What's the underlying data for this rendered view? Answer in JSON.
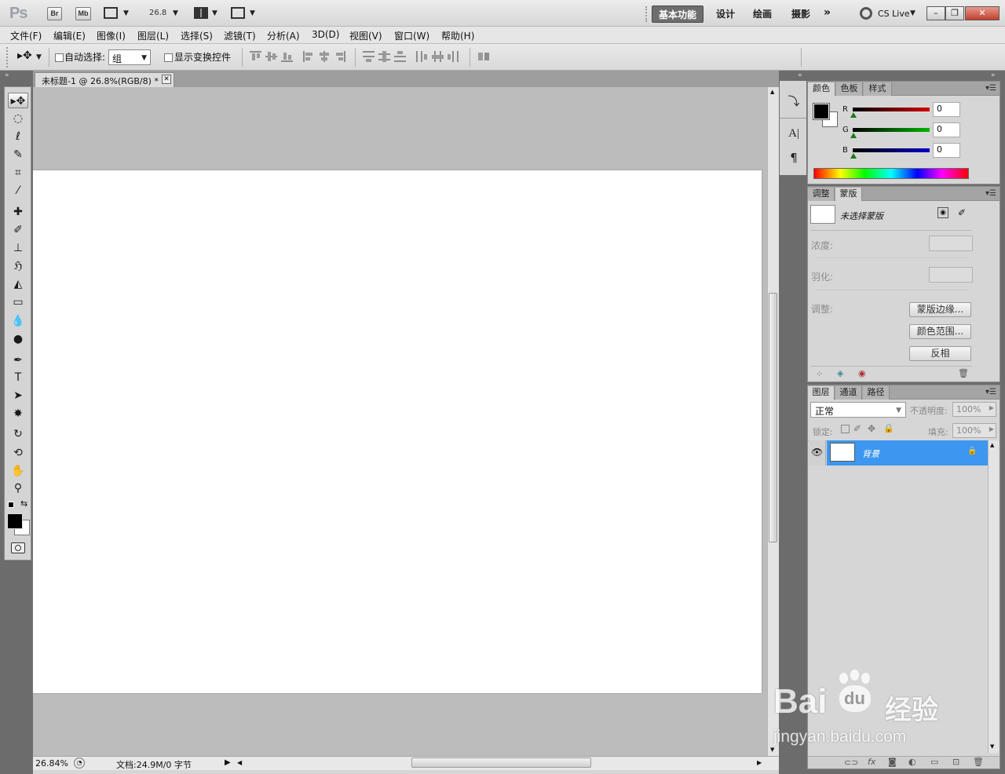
{
  "app": {
    "logo": "Ps",
    "bridge": "Br",
    "minibridge": "Mb",
    "zoom_display": "26.8"
  },
  "workspaces": [
    "基本功能",
    "设计",
    "绘画",
    "摄影"
  ],
  "workspace_active": "基本功能",
  "cs_live": "CS Live",
  "window_controls": {
    "min": "–",
    "restore": "❐",
    "close": "✕"
  },
  "menu": [
    "文件(F)",
    "编辑(E)",
    "图像(I)",
    "图层(L)",
    "选择(S)",
    "滤镜(T)",
    "分析(A)",
    "3D(D)",
    "视图(V)",
    "窗口(W)",
    "帮助(H)"
  ],
  "options": {
    "auto_select_label": "自动选择:",
    "auto_select_value": "组",
    "show_transform_label": "显示变换控件"
  },
  "document": {
    "tab_title": "未标题-1 @ 26.8%(RGB/8) *",
    "close": "✕",
    "zoom_status": "26.84%",
    "doc_info": "文档:24.9M/0 字节"
  },
  "tools": [
    {
      "name": "move-tool",
      "glyph": "▸✥"
    },
    {
      "name": "marquee-tool",
      "glyph": "◌"
    },
    {
      "name": "lasso-tool",
      "glyph": "ℓ"
    },
    {
      "name": "quick-select-tool",
      "glyph": "✎"
    },
    {
      "name": "crop-tool",
      "glyph": "⌗"
    },
    {
      "name": "eyedropper-tool",
      "glyph": "⁄"
    },
    {
      "name": "healing-brush-tool",
      "glyph": "✚"
    },
    {
      "name": "brush-tool",
      "glyph": "✐"
    },
    {
      "name": "clone-stamp-tool",
      "glyph": "⊥"
    },
    {
      "name": "history-brush-tool",
      "glyph": "ℌ"
    },
    {
      "name": "eraser-tool",
      "glyph": "◭"
    },
    {
      "name": "gradient-tool",
      "glyph": "▭"
    },
    {
      "name": "blur-tool",
      "glyph": "💧"
    },
    {
      "name": "dodge-tool",
      "glyph": "●"
    },
    {
      "name": "pen-tool",
      "glyph": "✒"
    },
    {
      "name": "type-tool",
      "glyph": "T"
    },
    {
      "name": "path-select-tool",
      "glyph": "➤"
    },
    {
      "name": "shape-tool",
      "glyph": "✸"
    },
    {
      "name": "3d-rotate-tool",
      "glyph": "↻"
    },
    {
      "name": "3d-orbit-tool",
      "glyph": "⟲"
    },
    {
      "name": "hand-tool",
      "glyph": "✋"
    },
    {
      "name": "zoom-tool",
      "glyph": "⚲"
    }
  ],
  "color_panel": {
    "tabs": [
      "颜色",
      "色板",
      "样式"
    ],
    "channels": [
      {
        "label": "R",
        "value": "0",
        "color": "#d40000"
      },
      {
        "label": "G",
        "value": "0",
        "color": "#00b400"
      },
      {
        "label": "B",
        "value": "0",
        "color": "#0000c8"
      }
    ]
  },
  "mask_panel": {
    "tabs": [
      "调整",
      "蒙版"
    ],
    "no_mask_label": "未选择蒙版",
    "density_label": "浓度:",
    "feather_label": "羽化:",
    "refine_label": "调整:",
    "buttons": [
      "蒙版边缘...",
      "颜色范围...",
      "反相"
    ]
  },
  "layers_panel": {
    "tabs": [
      "图层",
      "通道",
      "路径"
    ],
    "blend_mode": "正常",
    "opacity_label": "不透明度:",
    "opacity_value": "100%",
    "lock_label": "锁定:",
    "fill_label": "填充:",
    "fill_value": "100%",
    "layers": [
      {
        "name": "背景",
        "visible": true,
        "locked": true
      }
    ]
  },
  "watermark": {
    "brand": "Bai",
    "brand2": "du",
    "cn": "经验",
    "url": "jingyan.baidu.com"
  }
}
